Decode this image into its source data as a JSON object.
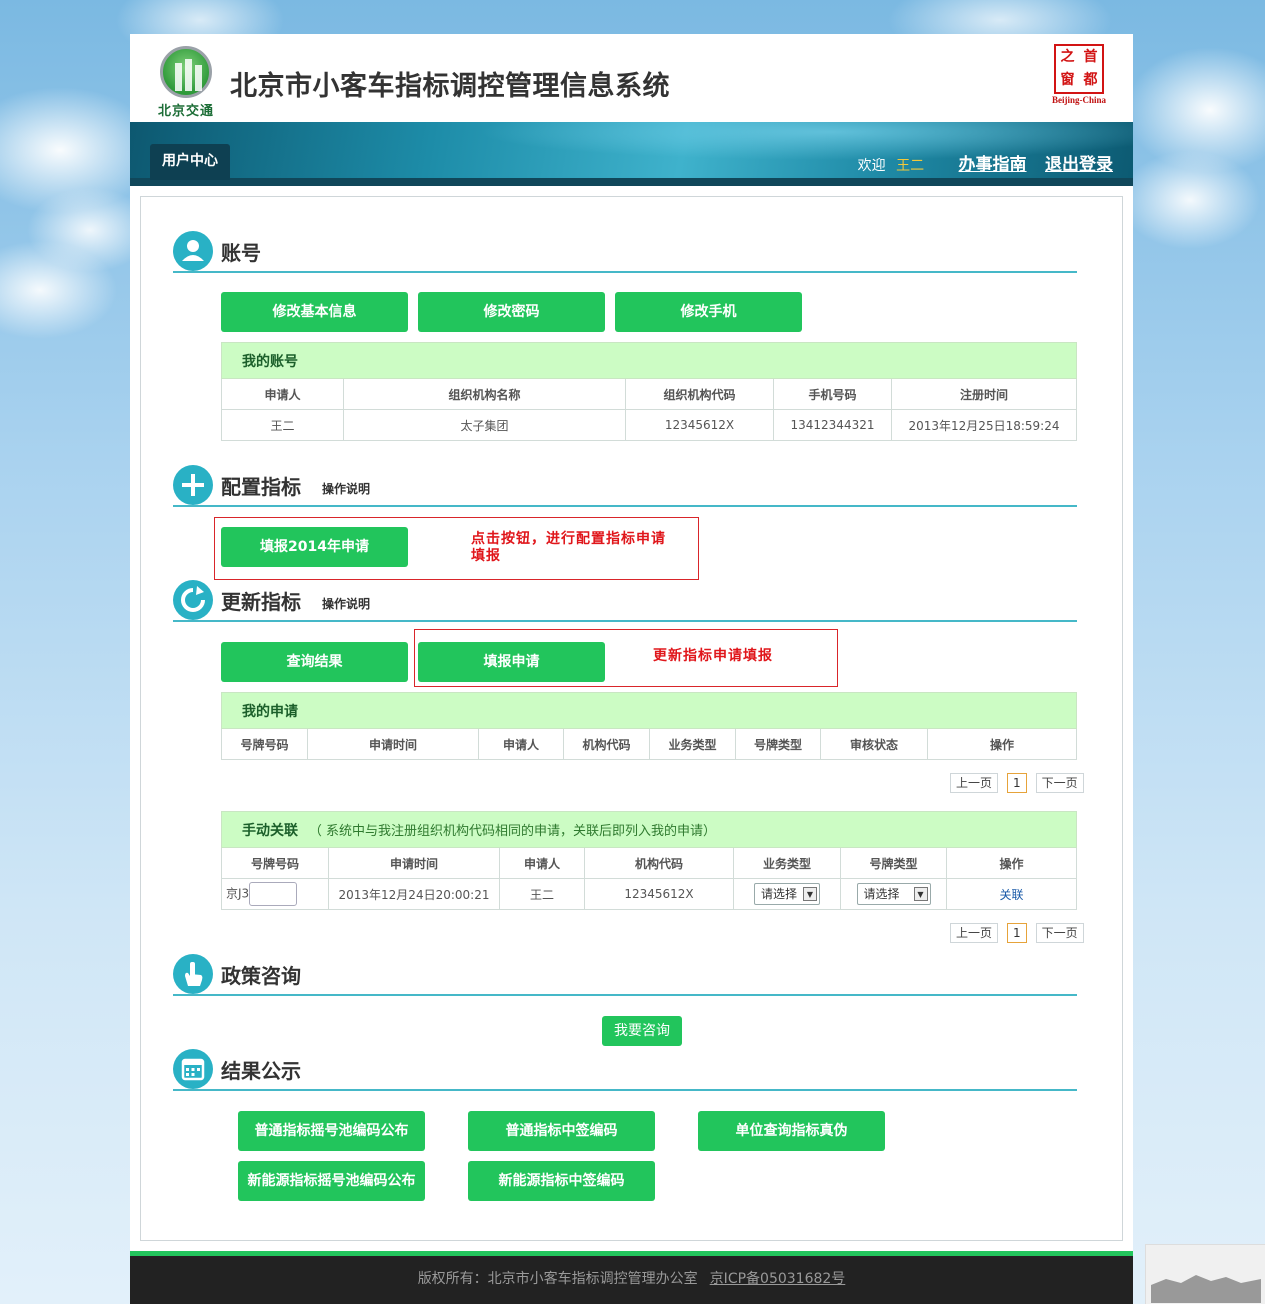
{
  "header": {
    "logo_text": "北京交通",
    "title": "北京市小客车指标调控管理信息系统",
    "seal_chars": [
      "首",
      "都",
      "之",
      "窗"
    ],
    "seal_caption": "Beijing-China"
  },
  "nav": {
    "user_center": "用户中心",
    "welcome": "欢迎",
    "username": "王二",
    "guide": "办事指南",
    "logout": "退出登录"
  },
  "account": {
    "title": "账号",
    "buttons": [
      "修改基本信息",
      "修改密码",
      "修改手机"
    ],
    "table_caption": "我的账号",
    "columns": [
      "申请人",
      "组织机构名称",
      "组织机构代码",
      "手机号码",
      "注册时间"
    ],
    "row": [
      "王二",
      "太子集团",
      "12345612X",
      "13412344321",
      "2013年12月25日18:59:24"
    ]
  },
  "config": {
    "title": "配置指标",
    "note": "操作说明",
    "button": "填报2014年申请",
    "annotation": "点击按钮，进行配置指标申请填报"
  },
  "update": {
    "title": "更新指标",
    "note": "操作说明",
    "buttons": [
      "查询结果",
      "填报申请"
    ],
    "annotation": "更新指标申请填报",
    "table_caption": "我的申请",
    "columns": [
      "号牌号码",
      "申请时间",
      "申请人",
      "机构代码",
      "业务类型",
      "号牌类型",
      "审核状态",
      "操作"
    ]
  },
  "pager": {
    "prev": "上一页",
    "page": "1",
    "next": "下一页"
  },
  "manual": {
    "caption": "手动关联",
    "caption_note": "（ 系统中与我注册组织机构代码相同的申请，关联后即列入我的申请）",
    "columns": [
      "号牌号码",
      "申请时间",
      "申请人",
      "机构代码",
      "业务类型",
      "号牌类型",
      "操作"
    ],
    "row": {
      "plate_prefix": "京J3",
      "time": "2013年12月24日20:00:21",
      "applicant": "王二",
      "org_code": "12345612X",
      "biz_type": "请选择",
      "plate_type": "请选择",
      "action": "关联"
    }
  },
  "policy": {
    "title": "政策咨询",
    "button": "我要咨询"
  },
  "results": {
    "title": "结果公示",
    "buttons": [
      "普通指标摇号池编码公布",
      "普通指标中签编码",
      "单位查询指标真伪",
      "新能源指标摇号池编码公布",
      "新能源指标中签编码"
    ]
  },
  "footer": {
    "copyright": "版权所有：北京市小客车指标调控管理办公室",
    "icp": "京ICP备05031682号"
  },
  "colors": {
    "green": "#22c55c",
    "teal": "#29b1c5",
    "caption_bg": "#ccfcc4",
    "annotation": "#e0161b"
  }
}
